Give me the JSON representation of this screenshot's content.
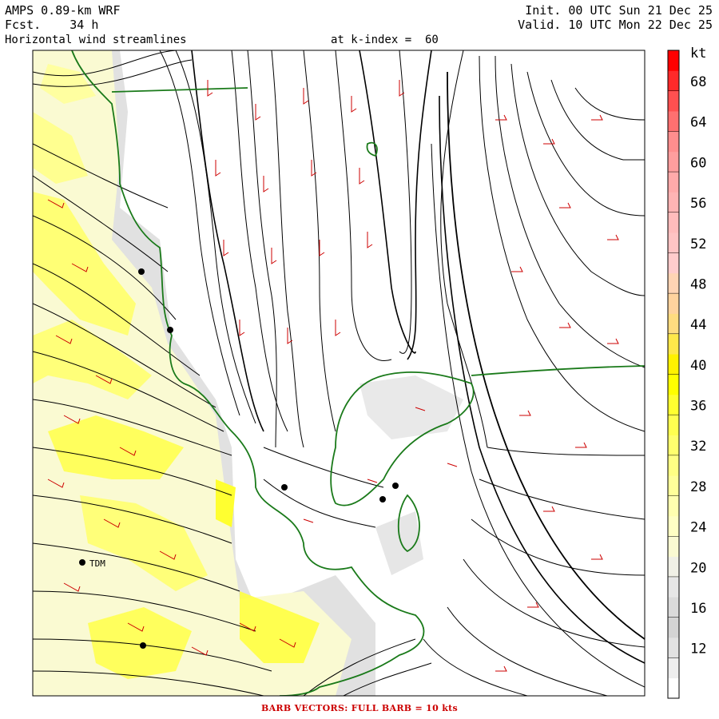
{
  "header": {
    "model": "AMPS 0.89-km WRF",
    "forecast": "Fcst.    34 h",
    "field": "Horizontal wind streamlines",
    "level": "at k-index =  60",
    "init": "Init. 00 UTC Sun 21 Dec 25",
    "valid": "Valid. 10 UTC Mon 22 Dec 25"
  },
  "footer": "BARB VECTORS:  FULL BARB = 10 kts",
  "colorbar": {
    "unit": "kt",
    "tick_labels": [
      "68",
      "64",
      "60",
      "56",
      "52",
      "48",
      "44",
      "40",
      "36",
      "32",
      "28",
      "24",
      "20",
      "16",
      "12"
    ],
    "bins": [
      {
        "lower": 0,
        "color": "#ffffff"
      },
      {
        "lower": 10,
        "color": "#eeeeee"
      },
      {
        "lower": 12,
        "color": "#e2e2e2"
      },
      {
        "lower": 14,
        "color": "#d4d4d4"
      },
      {
        "lower": 16,
        "color": "#dadada"
      },
      {
        "lower": 18,
        "color": "#e6e6e6"
      },
      {
        "lower": 20,
        "color": "#f0f0e6"
      },
      {
        "lower": 22,
        "color": "#fafad2"
      },
      {
        "lower": 24,
        "color": "#ffffc4"
      },
      {
        "lower": 26,
        "color": "#ffffb0"
      },
      {
        "lower": 28,
        "color": "#ffff9a"
      },
      {
        "lower": 30,
        "color": "#ffff84"
      },
      {
        "lower": 32,
        "color": "#ffff6e"
      },
      {
        "lower": 34,
        "color": "#ffff50"
      },
      {
        "lower": 36,
        "color": "#ffff30"
      },
      {
        "lower": 38,
        "color": "#ffff00"
      },
      {
        "lower": 40,
        "color": "#fff200"
      },
      {
        "lower": 42,
        "color": "#ffe84a"
      },
      {
        "lower": 44,
        "color": "#ffdc80"
      },
      {
        "lower": 46,
        "color": "#ffd39e"
      },
      {
        "lower": 48,
        "color": "#ffd4b4"
      },
      {
        "lower": 50,
        "color": "#ffcccc"
      },
      {
        "lower": 52,
        "color": "#ffc4c4"
      },
      {
        "lower": 54,
        "color": "#ffbcbc"
      },
      {
        "lower": 56,
        "color": "#ffb4b4"
      },
      {
        "lower": 58,
        "color": "#ffaaaa"
      },
      {
        "lower": 60,
        "color": "#ff9e9e"
      },
      {
        "lower": 62,
        "color": "#ff8e8e"
      },
      {
        "lower": 64,
        "color": "#ff7070"
      },
      {
        "lower": 66,
        "color": "#ff5050"
      },
      {
        "lower": 68,
        "color": "#ff2a2a"
      },
      {
        "lower": 70,
        "color": "#ff0000"
      }
    ]
  },
  "colors": {
    "streamline": "#000000",
    "coastline": "#1a7a1a",
    "barb": "#cc0000",
    "wind_shade_moderate": "#ffff60",
    "wind_shade_weak": "#fafad2",
    "terrain_gray": "#d6d6d6"
  },
  "stations": [
    {
      "name": "TDM",
      "label": "TDM"
    },
    {
      "name": "station-2",
      "label": ""
    },
    {
      "name": "station-3",
      "label": ""
    },
    {
      "name": "station-4",
      "label": ""
    },
    {
      "name": "station-5",
      "label": ""
    },
    {
      "name": "station-6",
      "label": ""
    },
    {
      "name": "station-7",
      "label": ""
    }
  ]
}
